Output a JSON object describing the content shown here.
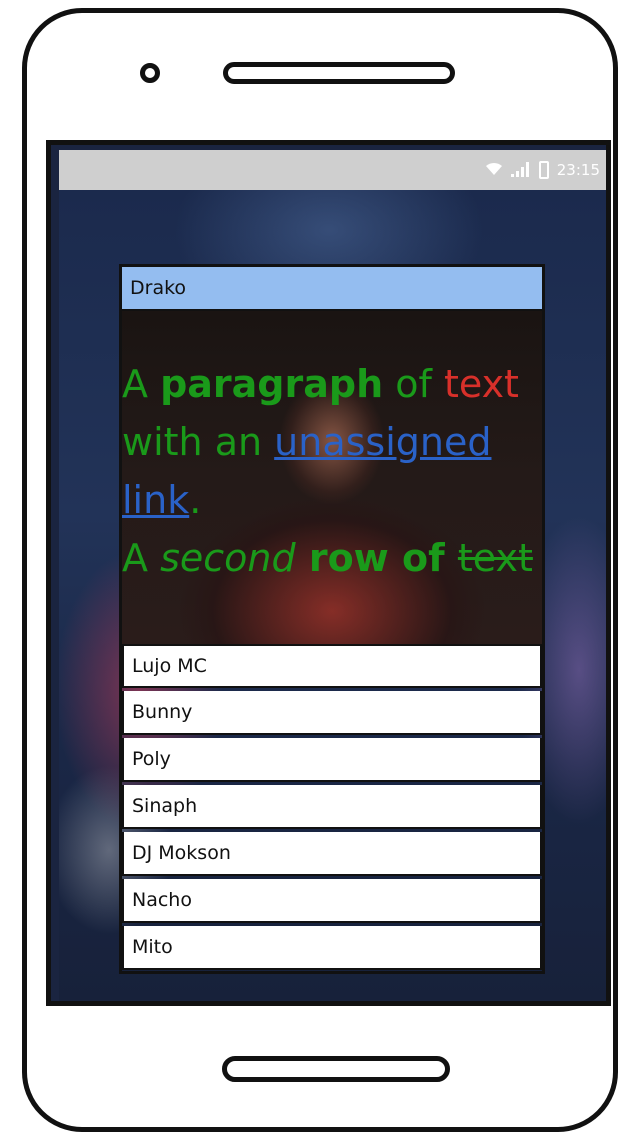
{
  "status_bar": {
    "time": "23:15",
    "icons": [
      "wifi-icon",
      "signal-icon",
      "battery-icon"
    ]
  },
  "card": {
    "header_title": "Drako"
  },
  "paragraph": {
    "p1": "A ",
    "p2": "paragraph",
    "p3": " of ",
    "p4": "text",
    "p5": " with an ",
    "p6": "unassigned link",
    "p7": ".",
    "p8": "A ",
    "p9": "second",
    "p10": " row of ",
    "p11": "text"
  },
  "artists": [
    "Lujo MC",
    "Bunny",
    "Poly",
    "Sinaph",
    "DJ Mokson",
    "Nacho",
    "Mito"
  ],
  "colors": {
    "header_bg": "#94bdf0",
    "text_green": "#1a9a1a",
    "text_red": "#d8302a",
    "link_blue": "#2a62c8",
    "status_bar_bg": "#cfcfcf"
  }
}
